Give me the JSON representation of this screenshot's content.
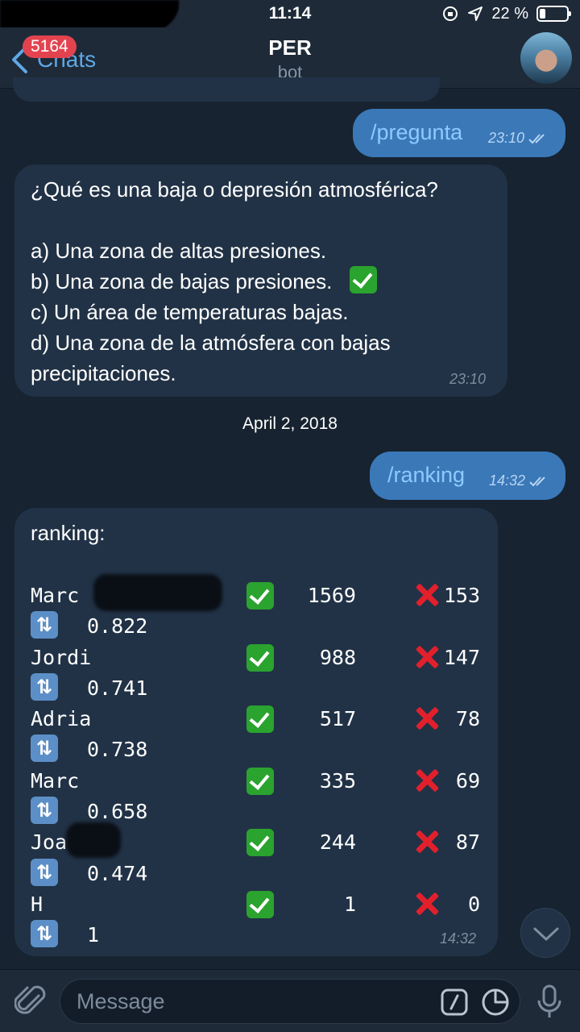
{
  "status_bar": {
    "time": "11:14",
    "battery_text": "22 %",
    "battery_level": 0.22
  },
  "nav": {
    "back_label": "Chats",
    "unread_count": "5164",
    "title": "PER",
    "subtitle": "bot"
  },
  "messages": {
    "cmd1": {
      "text": "/pregunta",
      "time": "23:10"
    },
    "question": {
      "lines": [
        "¿Qué es una baja o depresión atmosférica?",
        "",
        "a) Una zona de altas presiones.",
        "b) Una zona de bajas presiones.",
        "c) Un área de temperaturas bajas.",
        "d) Una zona de la atmósfera con bajas",
        "precipitaciones."
      ],
      "time": "23:10"
    },
    "date_separator": "April 2, 2018",
    "cmd2": {
      "text": "/ranking",
      "time": "14:32"
    },
    "ranking": {
      "header": "ranking:",
      "time": "14:32",
      "rows": [
        {
          "name": "Marc",
          "correct": "1569",
          "wrong": "153",
          "ratio": "0.822"
        },
        {
          "name": "Jordi",
          "correct": "988",
          "wrong": "147",
          "ratio": "0.741"
        },
        {
          "name": "Adria",
          "correct": "517",
          "wrong": "78",
          "ratio": "0.738"
        },
        {
          "name": "Marc",
          "correct": "335",
          "wrong": "69",
          "ratio": "0.658"
        },
        {
          "name": "Joa",
          "correct": "244",
          "wrong": "87",
          "ratio": "0.474"
        },
        {
          "name": "H",
          "correct": "1",
          "wrong": "0",
          "ratio": "1"
        }
      ]
    }
  },
  "input": {
    "placeholder": "Message"
  },
  "icons": {
    "check": "white-heavy-check-mark",
    "cross": "cross-mark",
    "repeat": "counterclockwise-arrows",
    "accent": "#5fa8e6"
  }
}
